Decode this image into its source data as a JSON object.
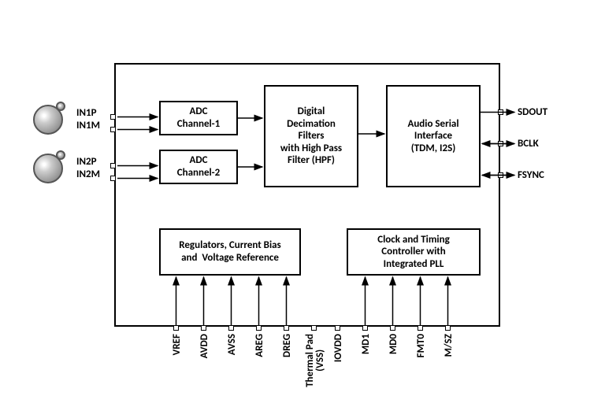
{
  "inputs": {
    "in1p": "IN1P",
    "in1m": "IN1M",
    "in2p": "IN2P",
    "in2m": "IN2M"
  },
  "outputs": {
    "sdout": "SDOUT",
    "bclk": "BCLK",
    "fsync": "FSYNC"
  },
  "blocks": {
    "adc1": "ADC\nChannel-1",
    "adc2": "ADC\nChannel-2",
    "decimation": "Digital\nDecimation\nFilters\nwith High Pass\nFilter (HPF)",
    "serial": "Audio Serial\nInterface\n(TDM, I2S)",
    "regulators": "Regulators, Current Bias\nand  Voltage Reference",
    "clock": "Clock and Timing\nController with\nIntegrated PLL"
  },
  "bottom_pins": {
    "vref": "VREF",
    "avdd": "AVDD",
    "avss": "AVSS",
    "areg": "AREG",
    "dreg": "DREG",
    "thermal": "Thermal Pad\n(VSS)",
    "iovdd": "IOVDD",
    "md1": "MD1",
    "md0": "MD0",
    "fmt0": "FMT0",
    "msz": "M/SZ"
  }
}
